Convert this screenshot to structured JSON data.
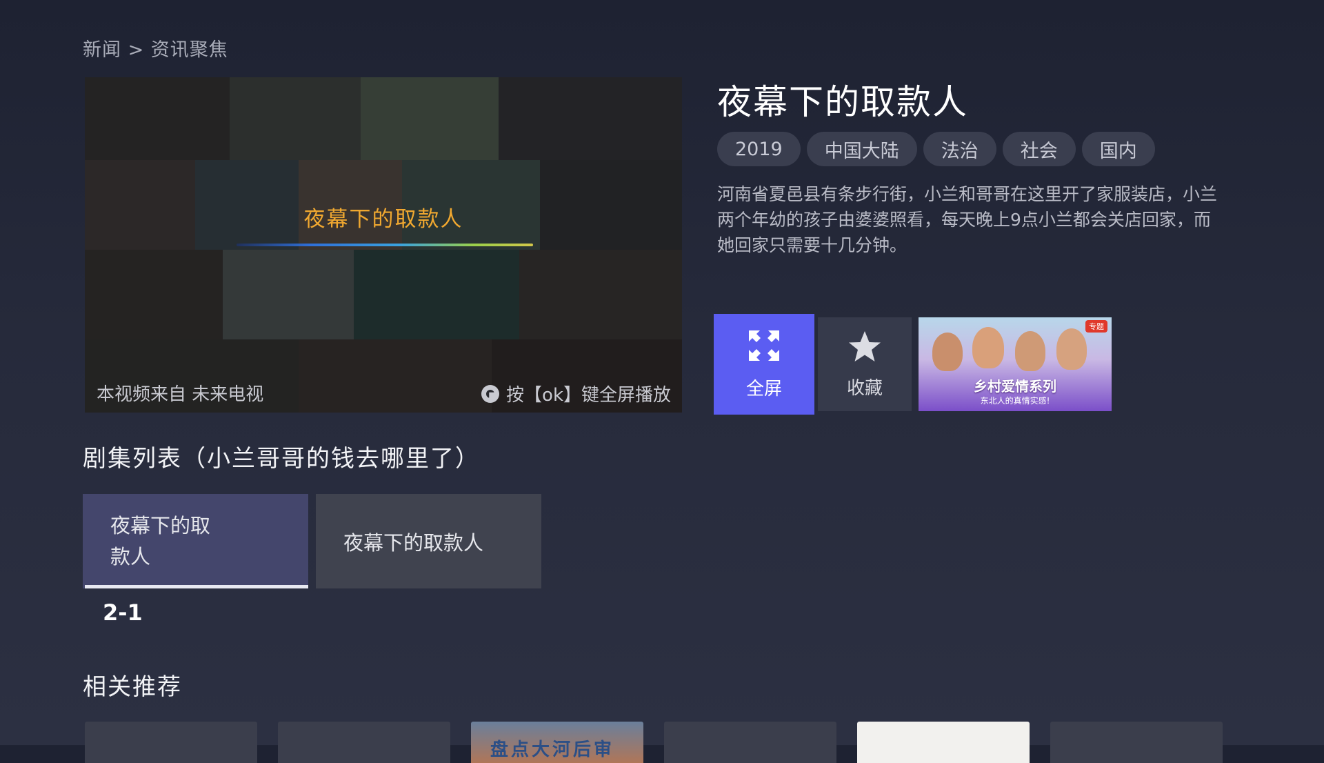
{
  "breadcrumb": "新闻 > 资讯聚焦",
  "player": {
    "overlay_title": "夜幕下的取款人",
    "source_text": "本视频来自 未来电视",
    "hint_text": "按【ok】键全屏播放",
    "hint_icon": "ok-button-icon"
  },
  "title": "夜幕下的取款人",
  "tags": [
    "2019",
    "中国大陆",
    "法治",
    "社会",
    "国内"
  ],
  "description": "河南省夏邑县有条步行街，小兰和哥哥在这里开了家服装店，小兰两个年幼的孩子由婆婆照看，每天晚上9点小兰都会关店回家，而她回家只需要十几分钟。",
  "actions": {
    "fullscreen_label": "全屏",
    "fullscreen_icon": "fullscreen-icon",
    "favorite_label": "收藏",
    "favorite_icon": "star-icon",
    "promo_badge": "专题",
    "promo_title": "乡村爱情系列",
    "promo_subtitle": "东北人的真情实感!"
  },
  "episodes": {
    "section_title": "剧集列表（小兰哥哥的钱去哪里了）",
    "items": [
      {
        "label": "夜幕下的取\n款人",
        "active": true
      },
      {
        "label": "夜幕下的取款人",
        "active": false
      }
    ],
    "range_label": "2-1"
  },
  "recommend": {
    "section_title": "相关推荐",
    "thumb3_caption": "盘点大河后审"
  },
  "colors": {
    "accent": "#5b5df2",
    "overlay_title": "#f0a830",
    "background": "#232737"
  }
}
